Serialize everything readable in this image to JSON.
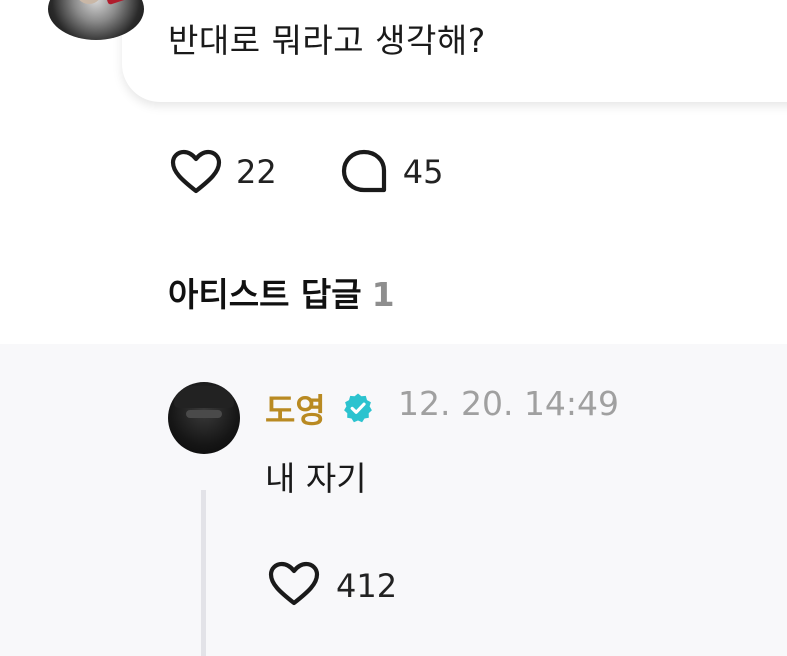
{
  "post": {
    "text": "반대로 뭐라고 생각해?"
  },
  "reactions": {
    "like_count": "22",
    "comment_count": "45"
  },
  "artist_replies": {
    "title": "아티스트 답글",
    "count": "1"
  },
  "reply": {
    "author": "도영",
    "timestamp": "12. 20. 14:49",
    "text": "내 자기",
    "like_count": "412"
  },
  "colors": {
    "artist_name": "#b98a22",
    "verified_badge": "#2cc3cf",
    "reply_background": "#f8f8fa"
  },
  "icons": {
    "like": "heart-outline-icon",
    "comment": "speech-bubble-outline-icon",
    "verified": "verified-badge-icon"
  }
}
